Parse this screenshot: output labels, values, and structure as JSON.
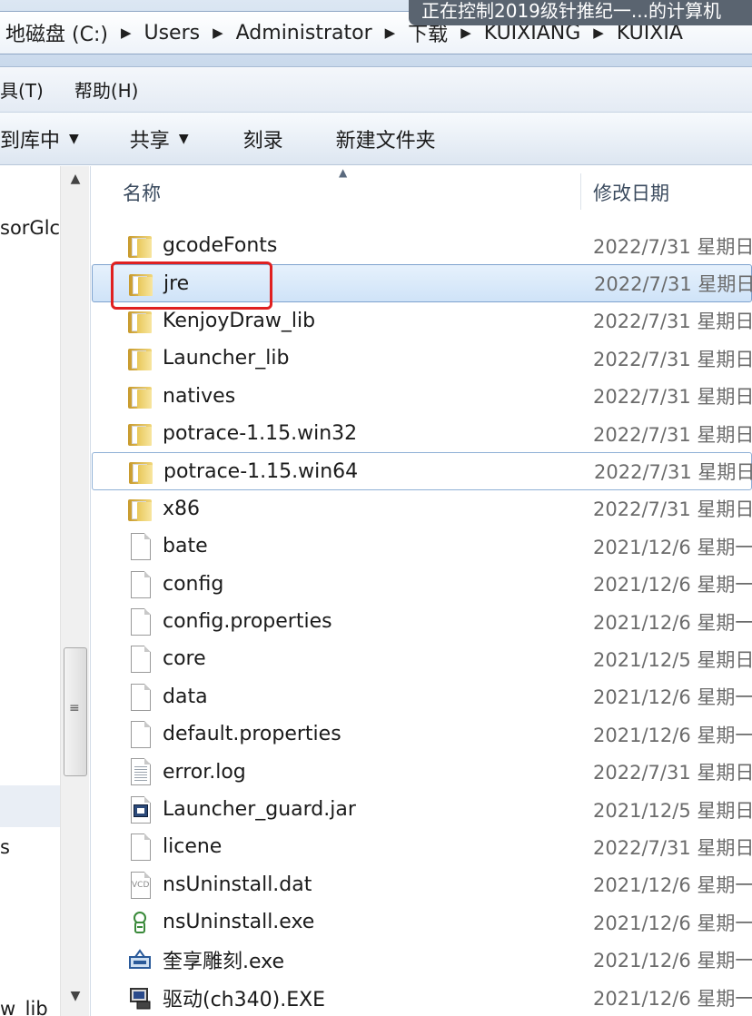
{
  "address": {
    "crumbs": [
      "地磁盘 (C:)",
      "Users",
      "Administrator",
      "下载",
      "KUIXIANG",
      "KUIXIA"
    ],
    "notice": "正在控制2019级针推纪一...的计算机"
  },
  "menu": {
    "items": [
      "具(T)",
      "帮助(H)"
    ]
  },
  "toolbar": {
    "include_library": "到库中",
    "share": "共享",
    "burn": "刻录",
    "new_folder": "新建文件夹"
  },
  "nav": {
    "item1": "sorGlc",
    "item2": "s",
    "item3": "w_lib"
  },
  "columns": {
    "name": "名称",
    "date": "修改日期"
  },
  "files": [
    {
      "name": "gcodeFonts",
      "date": "2022/7/31 星期日",
      "icon": "folder-icon"
    },
    {
      "name": "jre",
      "date": "2022/7/31 星期日",
      "icon": "folder-icon"
    },
    {
      "name": "KenjoyDraw_lib",
      "date": "2022/7/31 星期日",
      "icon": "folder-icon"
    },
    {
      "name": "Launcher_lib",
      "date": "2022/7/31 星期日",
      "icon": "folder-icon"
    },
    {
      "name": "natives",
      "date": "2022/7/31 星期日",
      "icon": "folder-icon"
    },
    {
      "name": "potrace-1.15.win32",
      "date": "2022/7/31 星期日",
      "icon": "folder-icon"
    },
    {
      "name": "potrace-1.15.win64",
      "date": "2022/7/31 星期日",
      "icon": "folder-icon"
    },
    {
      "name": "x86",
      "date": "2022/7/31 星期日",
      "icon": "folder-icon"
    },
    {
      "name": "bate",
      "date": "2021/12/6 星期一",
      "icon": "file-icon"
    },
    {
      "name": "config",
      "date": "2021/12/6 星期一",
      "icon": "file-icon"
    },
    {
      "name": "config.properties",
      "date": "2021/12/6 星期一",
      "icon": "file-icon"
    },
    {
      "name": "core",
      "date": "2021/12/5 星期日",
      "icon": "file-icon"
    },
    {
      "name": "data",
      "date": "2021/12/6 星期一",
      "icon": "file-icon"
    },
    {
      "name": "default.properties",
      "date": "2021/12/6 星期一",
      "icon": "file-icon"
    },
    {
      "name": "error.log",
      "date": "2022/7/31 星期日",
      "icon": "text-file-icon"
    },
    {
      "name": "Launcher_guard.jar",
      "date": "2021/12/5 星期日",
      "icon": "jar-file-icon"
    },
    {
      "name": "licene",
      "date": "2022/7/31 星期日",
      "icon": "file-icon"
    },
    {
      "name": "nsUninstall.dat",
      "date": "2021/12/6 星期一",
      "icon": "vcd-file-icon"
    },
    {
      "name": "nsUninstall.exe",
      "date": "2021/12/6 星期一",
      "icon": "uninstall-exe-icon"
    },
    {
      "name": "奎享雕刻.exe",
      "date": "2021/12/6 星期一",
      "icon": "app-exe-icon"
    },
    {
      "name": "驱动(ch340).EXE",
      "date": "2021/12/6 星期一",
      "icon": "driver-exe-icon"
    }
  ],
  "selected_index": 1,
  "focus_index": 6
}
